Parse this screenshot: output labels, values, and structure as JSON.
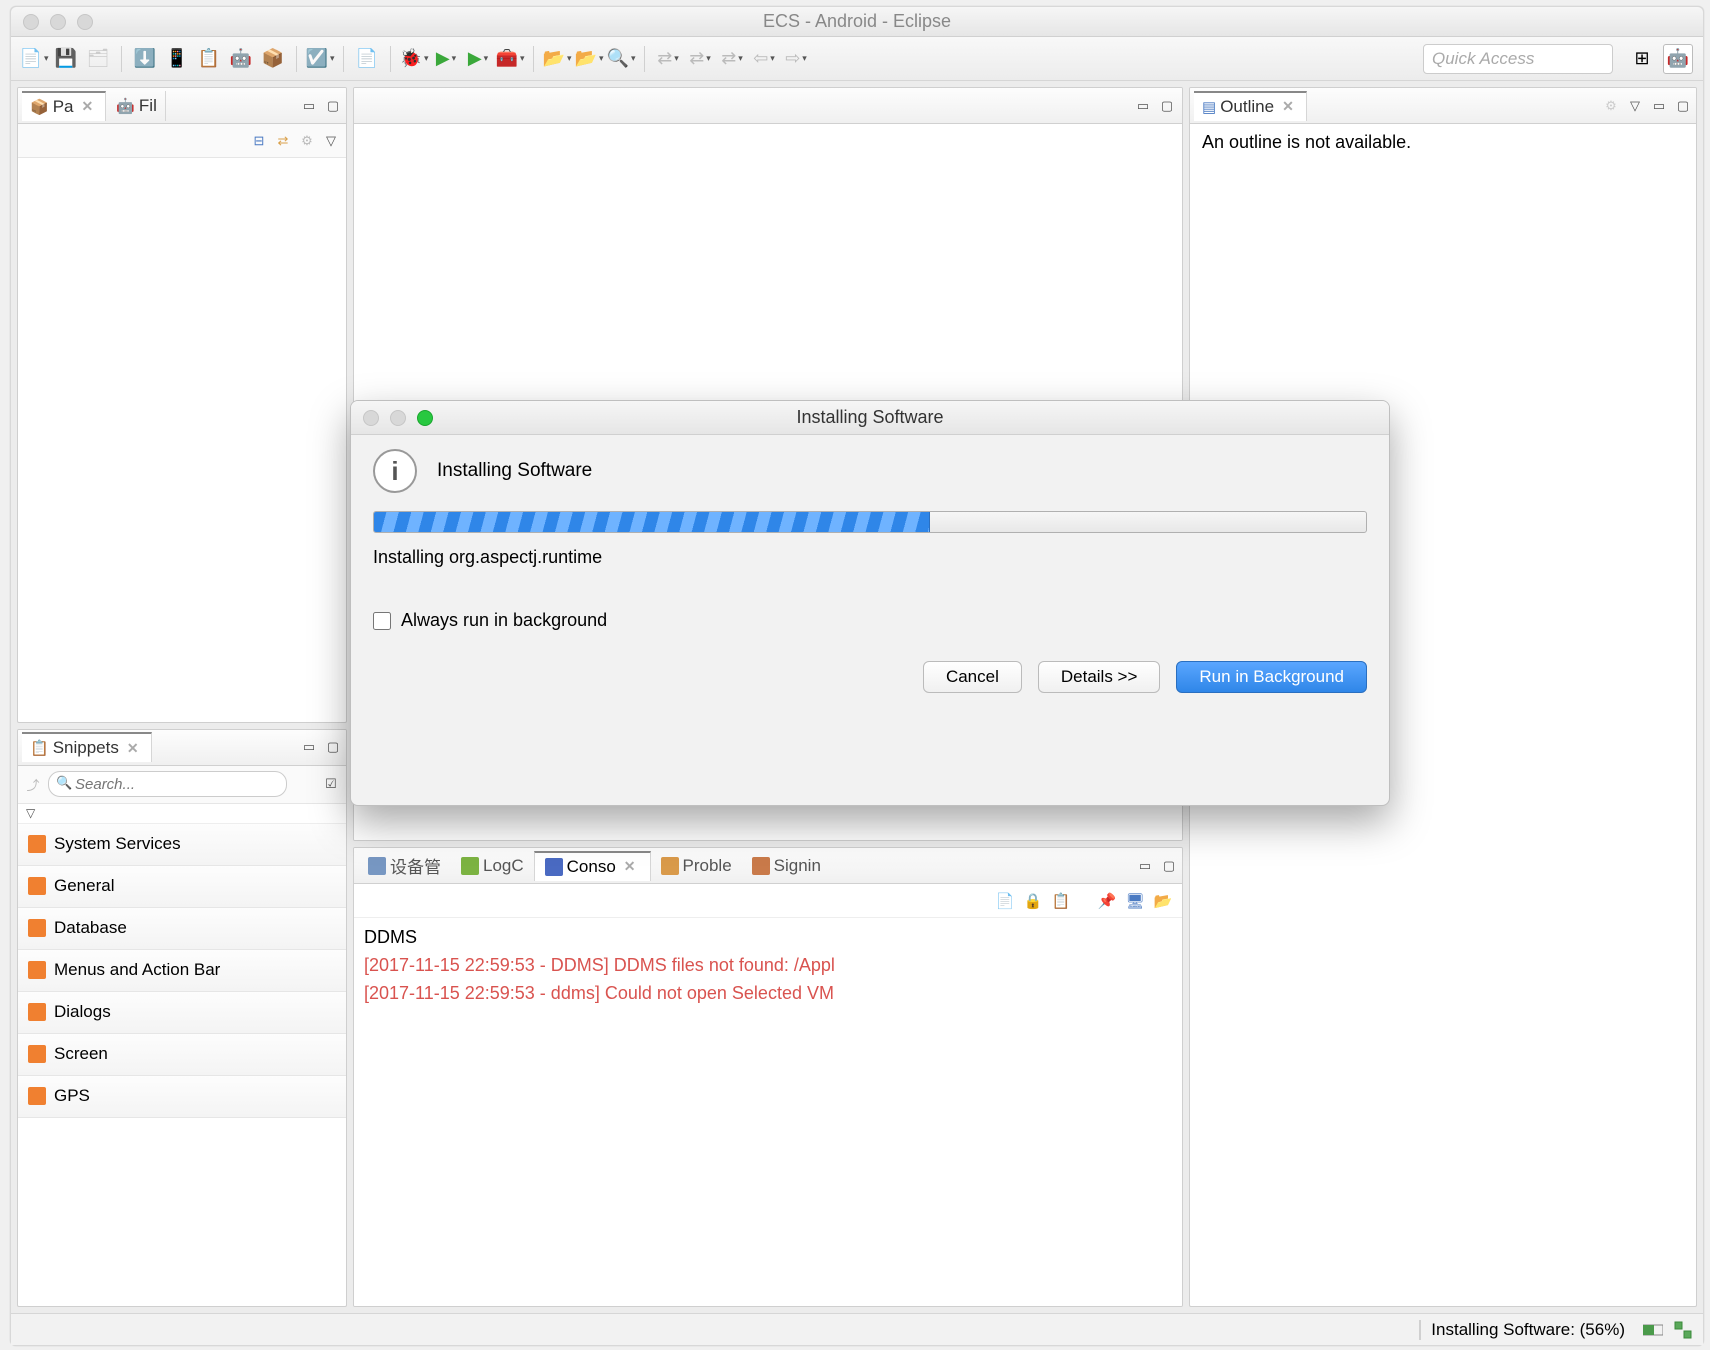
{
  "window": {
    "title": "ECS - Android - Eclipse",
    "quick_access_placeholder": "Quick Access"
  },
  "left": {
    "tab_package": "Pa",
    "tab_file": "Fil"
  },
  "outline": {
    "tab_label": "Outline",
    "message": "An outline is not available."
  },
  "snippets": {
    "tab_label": "Snippets",
    "search_placeholder": "Search...",
    "items": [
      "System Services",
      "General",
      "Database",
      "Menus and Action Bar",
      "Dialogs",
      "Screen",
      "GPS"
    ]
  },
  "bottom_tabs": {
    "device": "设备管",
    "logc": "LogC",
    "console": "Conso",
    "problems": "Proble",
    "signin": "Signin"
  },
  "console": {
    "title": "DDMS",
    "lines": [
      "[2017-11-15 22:59:53 - DDMS] DDMS files not found: /Appl",
      "[2017-11-15 22:59:53 - ddms] Could not open Selected VM "
    ]
  },
  "status": {
    "text": "Installing Software: (56%)"
  },
  "dialog": {
    "win_title": "Installing Software",
    "heading": "Installing Software",
    "status_line": "Installing org.aspectj.runtime",
    "progress_pct": 56,
    "always_bg": "Always run in background",
    "btn_cancel": "Cancel",
    "btn_details": "Details >>",
    "btn_bg": "Run in Background"
  }
}
